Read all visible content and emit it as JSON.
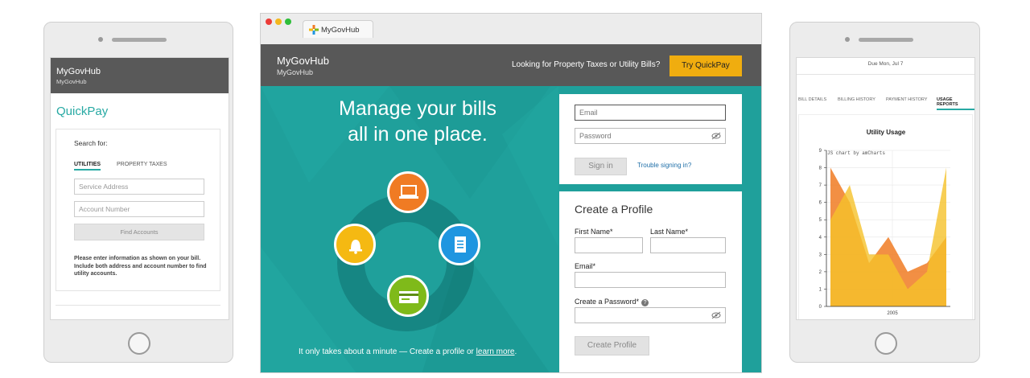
{
  "phone_left": {
    "header_title": "MyGovHub",
    "header_subtitle": "MyGovHub",
    "page_title": "QuickPay",
    "search_for": "Search for:",
    "tabs": [
      "UTILITIES",
      "PROPERTY TAXES"
    ],
    "service_address_placeholder": "Service Address",
    "account_number_placeholder": "Account Number",
    "find_button": "Find Accounts",
    "note": "Please enter information as shown on your bill. Include both address and account number to find utility accounts."
  },
  "browser": {
    "tab_label": "MyGovHub",
    "header": {
      "brand": "MyGovHub",
      "brand_sub": "MyGovHub",
      "prompt": "Looking for Property Taxes or Utility Bills?",
      "quickpay_button": "Try QuickPay"
    },
    "hero": {
      "headline_line1": "Manage your bills",
      "headline_line2": "all in one place.",
      "tagline_prefix": "It only takes about a minute — Create a profile or ",
      "tagline_link": "learn more",
      "tagline_suffix": "."
    },
    "signin": {
      "email_placeholder": "Email",
      "password_placeholder": "Password",
      "sign_in_button": "Sign in",
      "trouble_link": "Trouble signing in?"
    },
    "profile": {
      "title": "Create a Profile",
      "first_name_label": "First Name*",
      "last_name_label": "Last Name*",
      "email_label": "Email*",
      "password_label": "Create a Password*",
      "create_button": "Create Profile"
    },
    "icons": [
      "laptop-icon",
      "document-icon",
      "credit-card-icon",
      "bell-icon"
    ],
    "colors": {
      "teal": "#1fa09b",
      "orange": "#f07b23",
      "blue": "#1f96e0",
      "green": "#7fba1a",
      "yellow": "#f5b912",
      "quickpay": "#f0ad0f"
    }
  },
  "phone_right": {
    "due_text": "Due Mon, Jul 7",
    "tabs": [
      "BILL DETAILS",
      "BILLING HISTORY",
      "PAYMENT HISTORY",
      "USAGE REPORTS"
    ],
    "chart_credit": "JS chart by amCharts"
  },
  "chart_data": {
    "type": "area",
    "title": "Utility Usage",
    "x": [
      0,
      1,
      2,
      3,
      4,
      5,
      6
    ],
    "x_tick_labels": [
      "2005"
    ],
    "ylim": [
      0,
      9
    ],
    "y_ticks": [
      0,
      1,
      2,
      3,
      4,
      5,
      6,
      7,
      8,
      9
    ],
    "series": [
      {
        "color": "#f07b23",
        "values": [
          8,
          6,
          2.5,
          4,
          2,
          2.5,
          4
        ]
      },
      {
        "color": "#f5c22a",
        "values": [
          5,
          7,
          3,
          3,
          1,
          2,
          8
        ]
      }
    ],
    "grid": true
  }
}
